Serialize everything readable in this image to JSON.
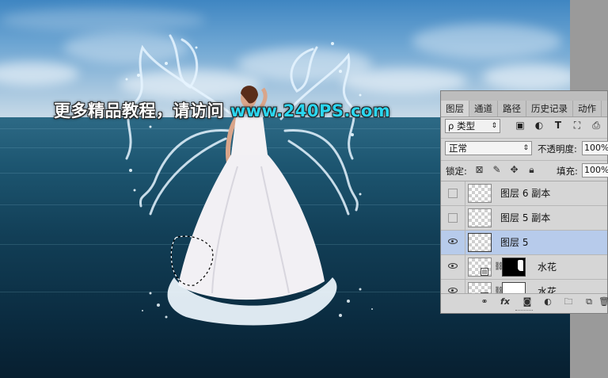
{
  "watermark": {
    "prefix": "更多精品教程，请访问 ",
    "url": "www.240PS.com"
  },
  "panel": {
    "tabs": [
      "图层",
      "通道",
      "路径",
      "历史记录",
      "动作"
    ],
    "active_tab": "图层",
    "filter": {
      "label": "ρ 类型"
    },
    "blend_mode": "正常",
    "opacity_label": "不透明度:",
    "opacity_value": "100%",
    "lock_label": "锁定:",
    "fill_label": "填充:",
    "fill_value": "100%",
    "layers": [
      {
        "name": "图层 6 副本",
        "visible": false,
        "selected": false
      },
      {
        "name": "图层 5 副本",
        "visible": false,
        "selected": false
      },
      {
        "name": "图层 5",
        "visible": true,
        "selected": true
      },
      {
        "name": "水花",
        "visible": true,
        "selected": false
      },
      {
        "name": "水花",
        "visible": true,
        "selected": false
      }
    ]
  },
  "colors": {
    "selected_row": "#b7cbeb",
    "watermark_url": "#2ad6f0",
    "panel_bg": "#d6d6d6"
  }
}
